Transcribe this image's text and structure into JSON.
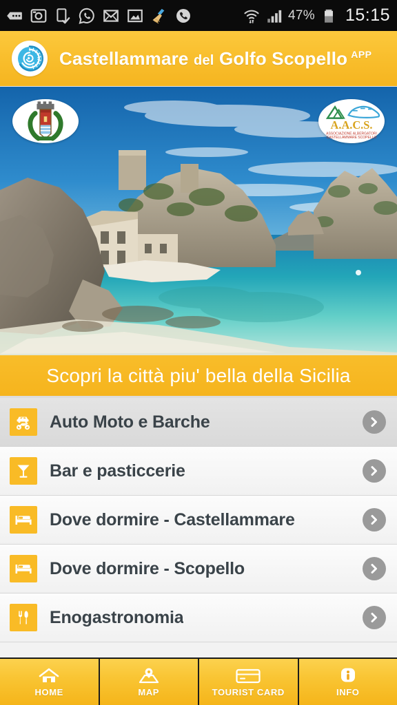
{
  "statusbar": {
    "icons": [
      "sms-message-icon",
      "instagram-camera-icon",
      "phone-download-icon",
      "whatsapp-icon",
      "gmail-icon",
      "gallery-photo-icon",
      "broom-cleaner-icon",
      "phone-call-icon",
      "wifi-signal-icon",
      "cellular-signal-icon"
    ],
    "battery_percent": "47%",
    "battery_icon": "battery-icon",
    "time": "15:15",
    "background": "#0b0b0b"
  },
  "header": {
    "logo_icon": "spiral-shell-logo-icon",
    "title_main": "Castellammare",
    "title_del": "del",
    "title_rest": "Golfo Scopello",
    "title_sup": "APP",
    "background": "#f9bf2e",
    "text_color": "#ffffff"
  },
  "hero": {
    "alt_name": "tonnara-di-scopello-photo",
    "badge_left": {
      "name": "comune-coat-of-arms-badge",
      "label": ""
    },
    "badge_right": {
      "name": "aacs-association-badge",
      "acronym": "A.A.C.S.",
      "line1": "ASSOCIAZIONE ALBERGATORI",
      "line2": "CASTELLAMMARE SCOPELLO"
    }
  },
  "tagline": {
    "text": "Scopri la città piu' bella della Sicilia",
    "background": "#f7b922"
  },
  "list": {
    "items": [
      {
        "label": "Auto Moto e Barche",
        "icon": "car-scooter-icon",
        "highlighted": true
      },
      {
        "label": "Bar e pasticcerie",
        "icon": "cocktail-glass-icon",
        "highlighted": false
      },
      {
        "label": "Dove dormire - Castellammare",
        "icon": "bed-icon",
        "highlighted": false
      },
      {
        "label": "Dove dormire - Scopello",
        "icon": "bed-icon",
        "highlighted": false
      },
      {
        "label": "Enogastronomia",
        "icon": "fork-knife-icon",
        "highlighted": false
      }
    ],
    "chevron_icon": "chevron-right-icon",
    "icon_background": "#f9bb26",
    "label_color": "#3a4349"
  },
  "bottomnav": {
    "items": [
      {
        "label": "HOME",
        "icon": "home-icon"
      },
      {
        "label": "MAP",
        "icon": "map-pin-icon"
      },
      {
        "label": "TOURIST CARD",
        "icon": "credit-card-icon"
      },
      {
        "label": "INFO",
        "icon": "info-circle-icon"
      }
    ],
    "background": "#f9c534"
  }
}
